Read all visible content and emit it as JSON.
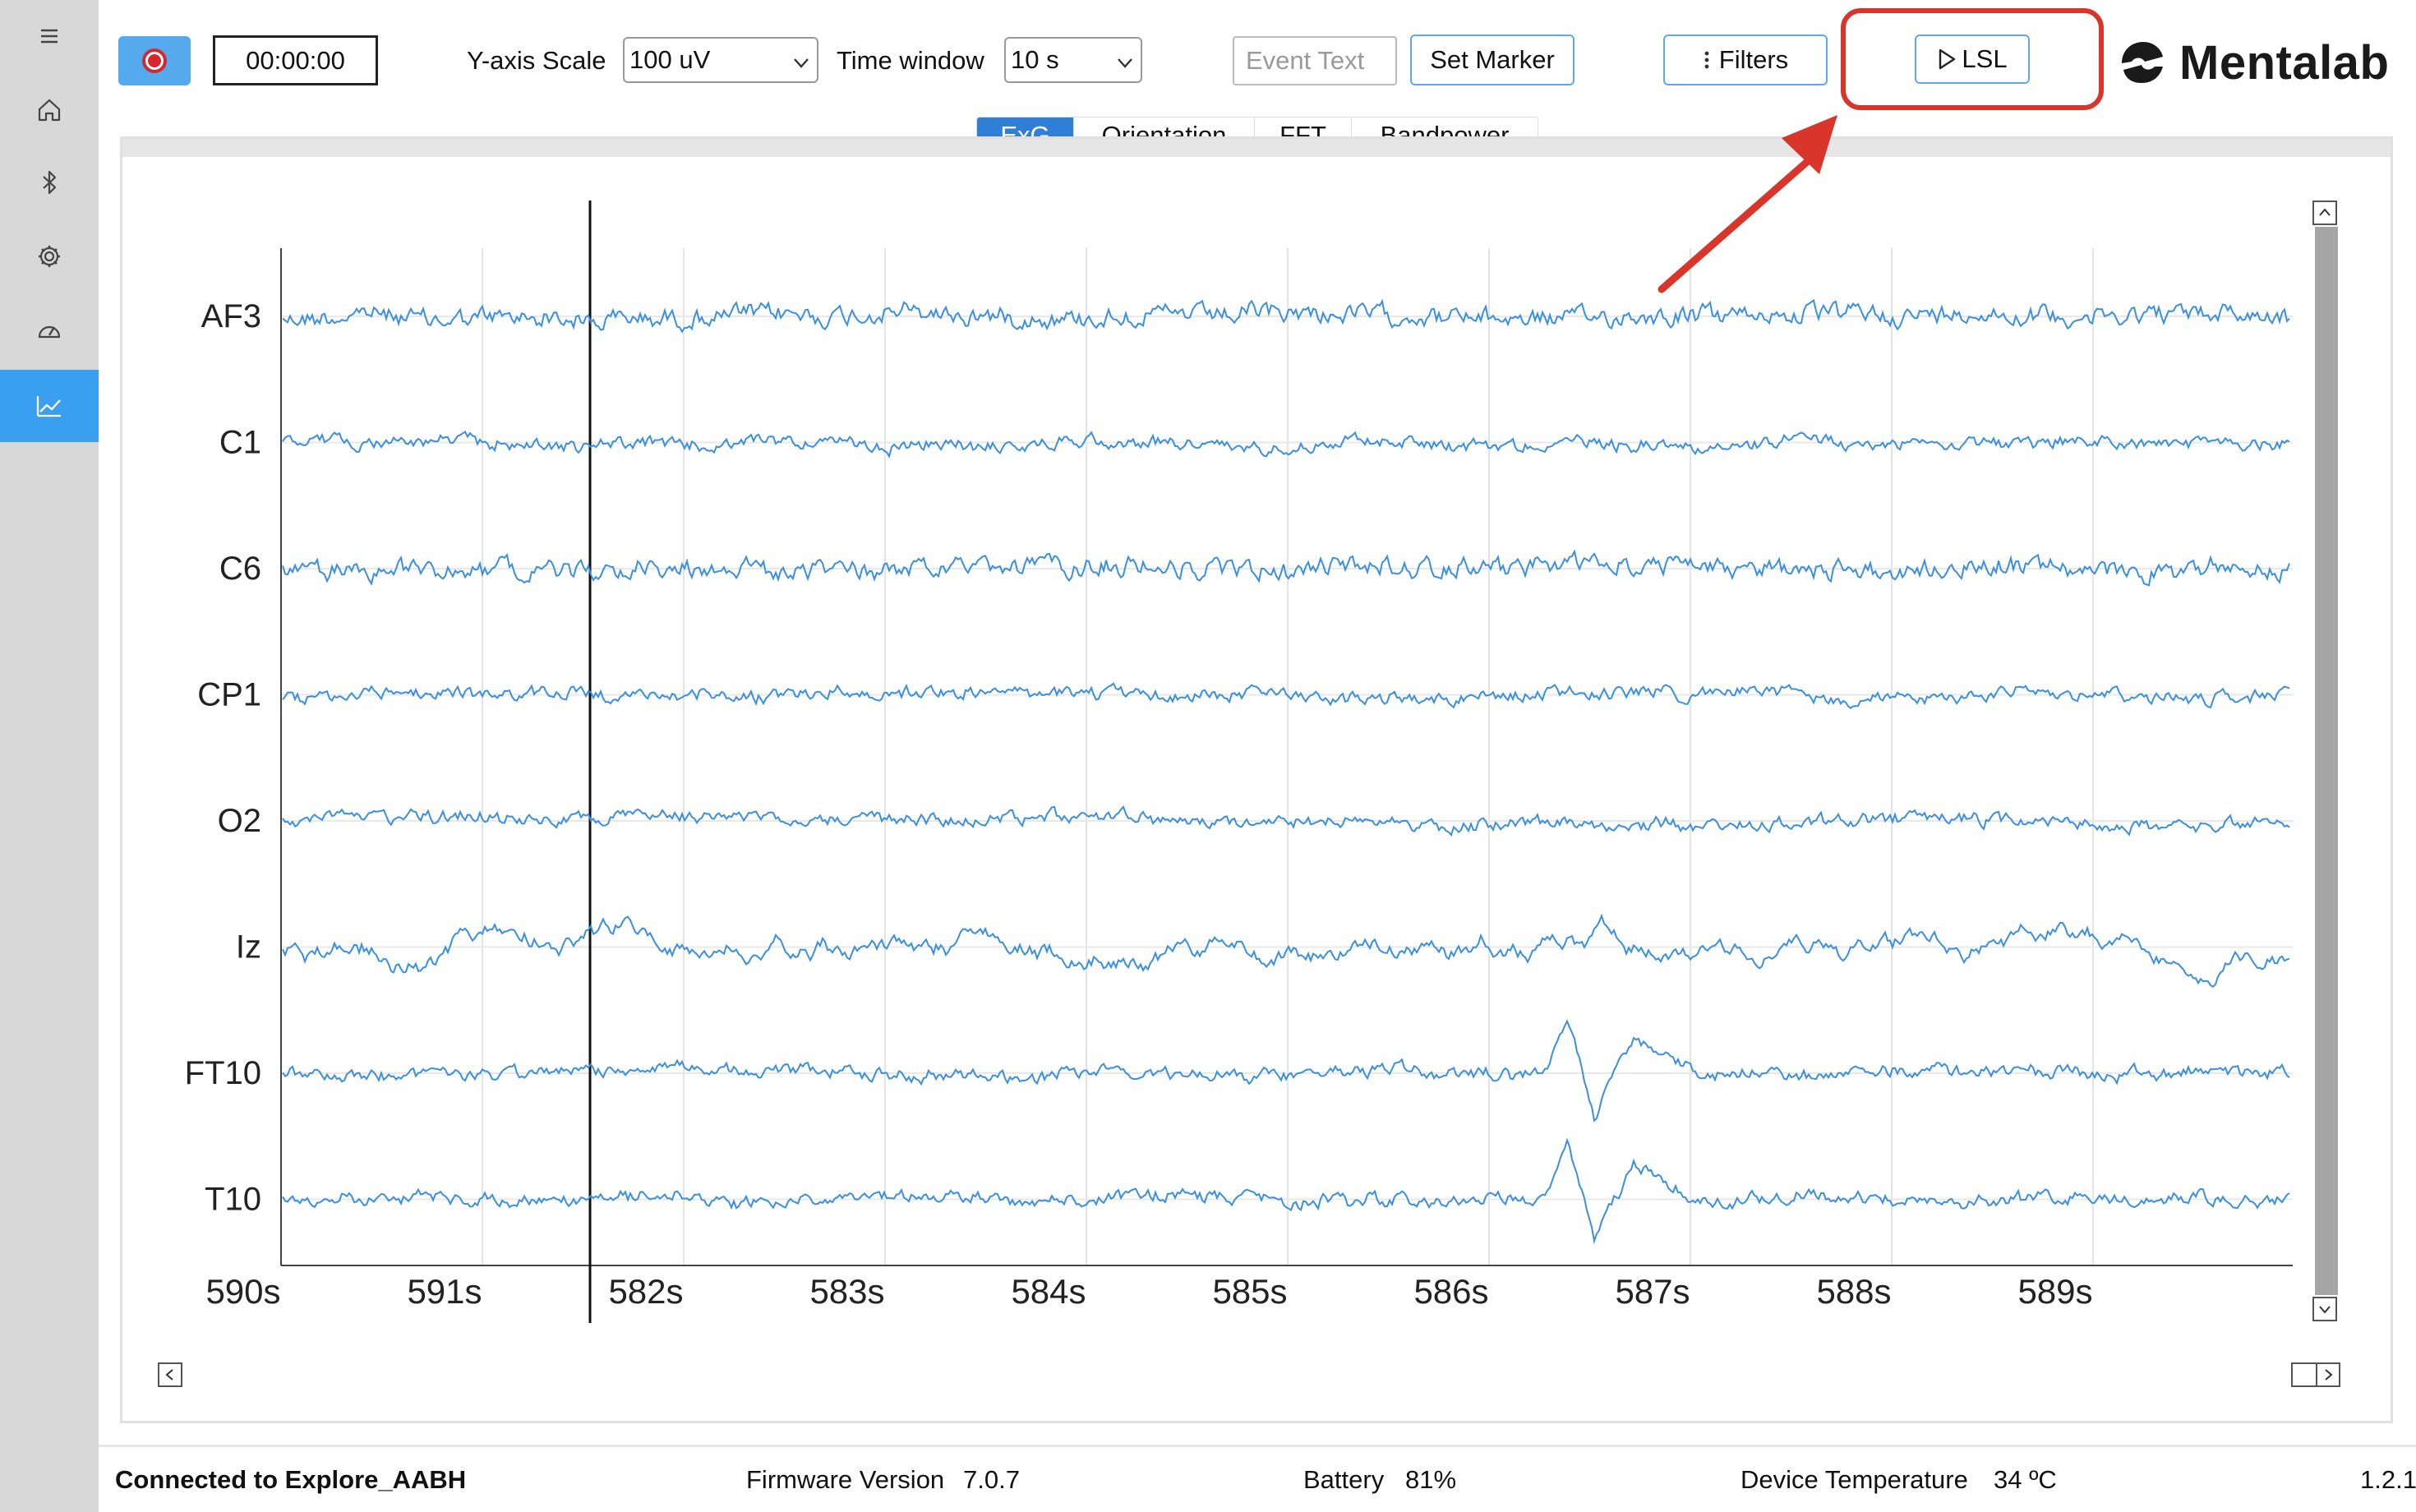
{
  "sidebar": {
    "items": [
      {
        "name": "menu-icon",
        "active": false
      },
      {
        "name": "home-icon",
        "active": false
      },
      {
        "name": "bluetooth-icon",
        "active": false
      },
      {
        "name": "gear-icon",
        "active": false
      },
      {
        "name": "gauge-icon",
        "active": false
      },
      {
        "name": "chart-icon",
        "active": true
      }
    ]
  },
  "toolbar": {
    "timer": "00:00:00",
    "y_scale_label": "Y-axis Scale",
    "y_scale_value": "100 uV",
    "time_window_label": "Time window",
    "time_window_value": "10 s",
    "event_text_placeholder": "Event Text",
    "set_marker_label": "Set Marker",
    "filters_label": "Filters",
    "lsl_label": "LSL"
  },
  "logo": {
    "text": "Mentalab"
  },
  "tabs": [
    "ExG",
    "Orientation",
    "FFT",
    "Bandpower"
  ],
  "active_tab": "ExG",
  "chart_data": {
    "type": "line",
    "channels": [
      "AF3",
      "C1",
      "C6",
      "CP1",
      "O2",
      "Iz",
      "FT10",
      "T10"
    ],
    "x_tick_labels": [
      "590s",
      "591s",
      "582s",
      "583s",
      "584s",
      "585s",
      "586s",
      "587s",
      "588s",
      "589s"
    ],
    "y_scale": "100 uV",
    "time_window": "10 s",
    "grid": true,
    "color": "#3a8fe0"
  },
  "status": {
    "connection": "Connected to Explore_AABH",
    "firmware_label": "Firmware Version",
    "firmware_value": "7.0.7",
    "battery_label": "Battery",
    "battery_value": "81%",
    "temperature_label": "Device Temperature",
    "temperature_value": "34 ºC",
    "version": "1.2.1"
  }
}
